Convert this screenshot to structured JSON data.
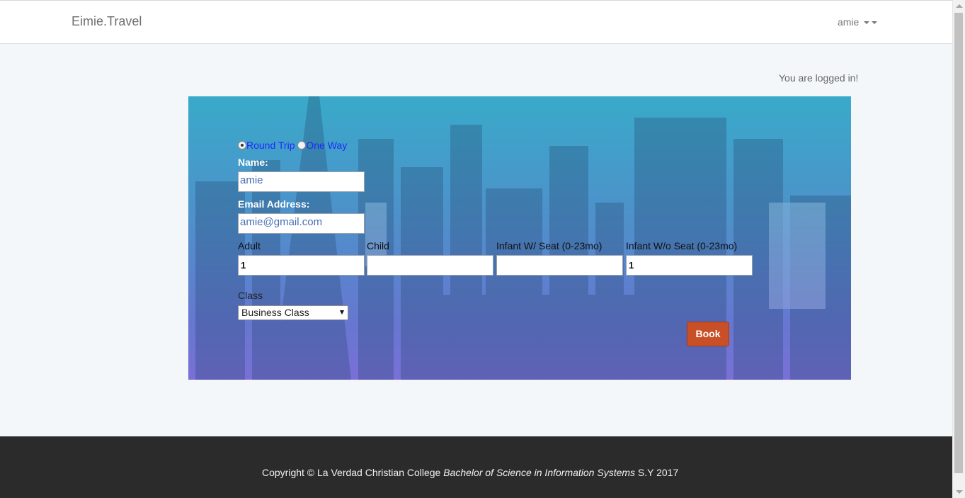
{
  "navbar": {
    "brand": "Eimie.Travel",
    "user_menu_label": "amie"
  },
  "status": {
    "logged_in_message": "You are logged in!"
  },
  "booking_form": {
    "trip_types": [
      {
        "label": "Round Trip",
        "selected": true
      },
      {
        "label": "One Way",
        "selected": false
      }
    ],
    "name_label": "Name:",
    "name_value": "amie",
    "email_label": "Email Address:",
    "email_value": "amie@gmail.com",
    "passengers": [
      {
        "label": "Adult",
        "value": "1"
      },
      {
        "label": "Child",
        "value": ""
      },
      {
        "label": "Infant W/ Seat (0-23mo)",
        "value": ""
      },
      {
        "label": "Infant W/o Seat (0-23mo)",
        "value": "1"
      }
    ],
    "class_label": "Class",
    "class_selected": "Business Class",
    "book_button": "Book"
  },
  "footer": {
    "prefix": "Copyright © La Verdad Christian College ",
    "program": "Bachelor of Science in Information Systems",
    "suffix": " S.Y 2017"
  },
  "colors": {
    "panel_top": "#39aac9",
    "panel_bottom": "#7a70d6",
    "book_button": "#c94f27",
    "footer_bg": "#2b2b2c",
    "link_blue": "#1a2bff"
  }
}
